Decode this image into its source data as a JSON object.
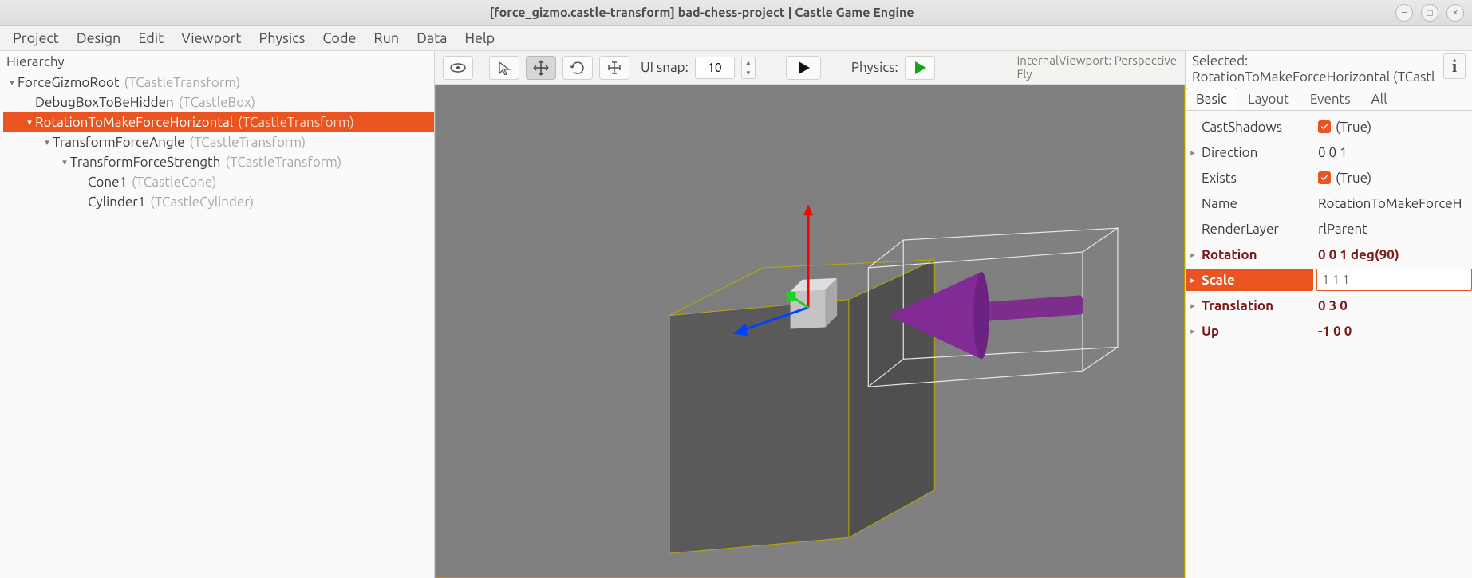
{
  "window": {
    "title": "[force_gizmo.castle-transform] bad-chess-project | Castle Game Engine"
  },
  "menu": [
    "Project",
    "Design",
    "Edit",
    "Viewport",
    "Physics",
    "Code",
    "Run",
    "Data",
    "Help"
  ],
  "hierarchy": {
    "header": "Hierarchy",
    "items": [
      {
        "name": "ForceGizmoRoot",
        "type": "(TCastleTransform)",
        "depth": 0,
        "exp": "▾",
        "sel": false
      },
      {
        "name": "DebugBoxToBeHidden",
        "type": "(TCastleBox)",
        "depth": 1,
        "exp": "",
        "sel": false
      },
      {
        "name": "RotationToMakeForceHorizontal",
        "type": "(TCastleTransform)",
        "depth": 1,
        "exp": "▾",
        "sel": true
      },
      {
        "name": "TransformForceAngle",
        "type": "(TCastleTransform)",
        "depth": 2,
        "exp": "▾",
        "sel": false
      },
      {
        "name": "TransformForceStrength",
        "type": "(TCastleTransform)",
        "depth": 3,
        "exp": "▾",
        "sel": false
      },
      {
        "name": "Cone1",
        "type": "(TCastleCone)",
        "depth": 4,
        "exp": "",
        "sel": false
      },
      {
        "name": "Cylinder1",
        "type": "(TCastleCylinder)",
        "depth": 4,
        "exp": "",
        "sel": false
      }
    ]
  },
  "toolbar": {
    "ui_snap_label": "UI snap:",
    "ui_snap_value": "10",
    "physics_label": "Physics:",
    "viewport_info_line1": "InternalViewport: Perspective",
    "viewport_info_line2": "Fly"
  },
  "selection": {
    "label": "Selected:",
    "value": "RotationToMakeForceHorizontal (TCastl"
  },
  "tabs": [
    "Basic",
    "Layout",
    "Events",
    "All"
  ],
  "props": {
    "CastShadows": {
      "label": "CastShadows",
      "value": "(True)",
      "check": true
    },
    "Direction": {
      "label": "Direction",
      "value": "0 0 1"
    },
    "Exists": {
      "label": "Exists",
      "value": "(True)",
      "check": true
    },
    "Name": {
      "label": "Name",
      "value": "RotationToMakeForceH"
    },
    "RenderLayer": {
      "label": "RenderLayer",
      "value": "rlParent"
    },
    "Rotation": {
      "label": "Rotation",
      "value": "0 0 1 deg(90)"
    },
    "Scale": {
      "label": "Scale",
      "value": "1 1 1"
    },
    "Translation": {
      "label": "Translation",
      "value": "0 3 0"
    },
    "Up": {
      "label": "Up",
      "value": "-1 0 0"
    }
  }
}
